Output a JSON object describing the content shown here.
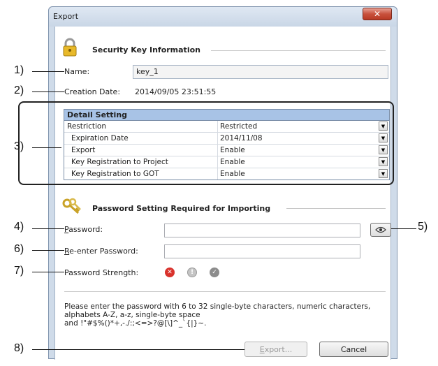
{
  "window": {
    "title": "Export",
    "close_glyph": "✕"
  },
  "security": {
    "heading": "Security Key Information",
    "name_label": "Name:",
    "name_value": "key_1",
    "creation_label": "Creation Date:",
    "creation_value": "2014/09/05 23:51:55"
  },
  "detail": {
    "heading": "Detail Setting",
    "rows": [
      {
        "name": "Restriction",
        "value": "Restricted"
      },
      {
        "name": "Expiration Date",
        "value": "2014/11/08"
      },
      {
        "name": "Export",
        "value": "Enable"
      },
      {
        "name": "Key Registration to Project",
        "value": "Enable"
      },
      {
        "name": "Key Registration to GOT",
        "value": "Enable"
      }
    ]
  },
  "password": {
    "heading": "Password Setting Required for Importing",
    "password_label_key": "P",
    "password_label_rest": "assword:",
    "reenter_label_key": "R",
    "reenter_label_rest": "e-enter Password:",
    "strength_label": "Password Strength:",
    "note": "Please enter the password with 6 to 32 single-byte characters, numeric characters,\nalphabets A-Z, a-z, single-byte space\nand !\"#$%()*+,-./:;<=>?@[\\]^_`{|}~."
  },
  "buttons": {
    "export_key": "E",
    "export_rest": "xport...",
    "cancel": "Cancel"
  },
  "callouts": [
    "1)",
    "2)",
    "3)",
    "4)",
    "5)",
    "6)",
    "7)",
    "8)"
  ],
  "colors": {
    "strength_weak": "#d9322c",
    "strength_mid": "#b3b3b3",
    "strength_ok": "#8c8c8c",
    "table_header": "#a8c3e6"
  }
}
